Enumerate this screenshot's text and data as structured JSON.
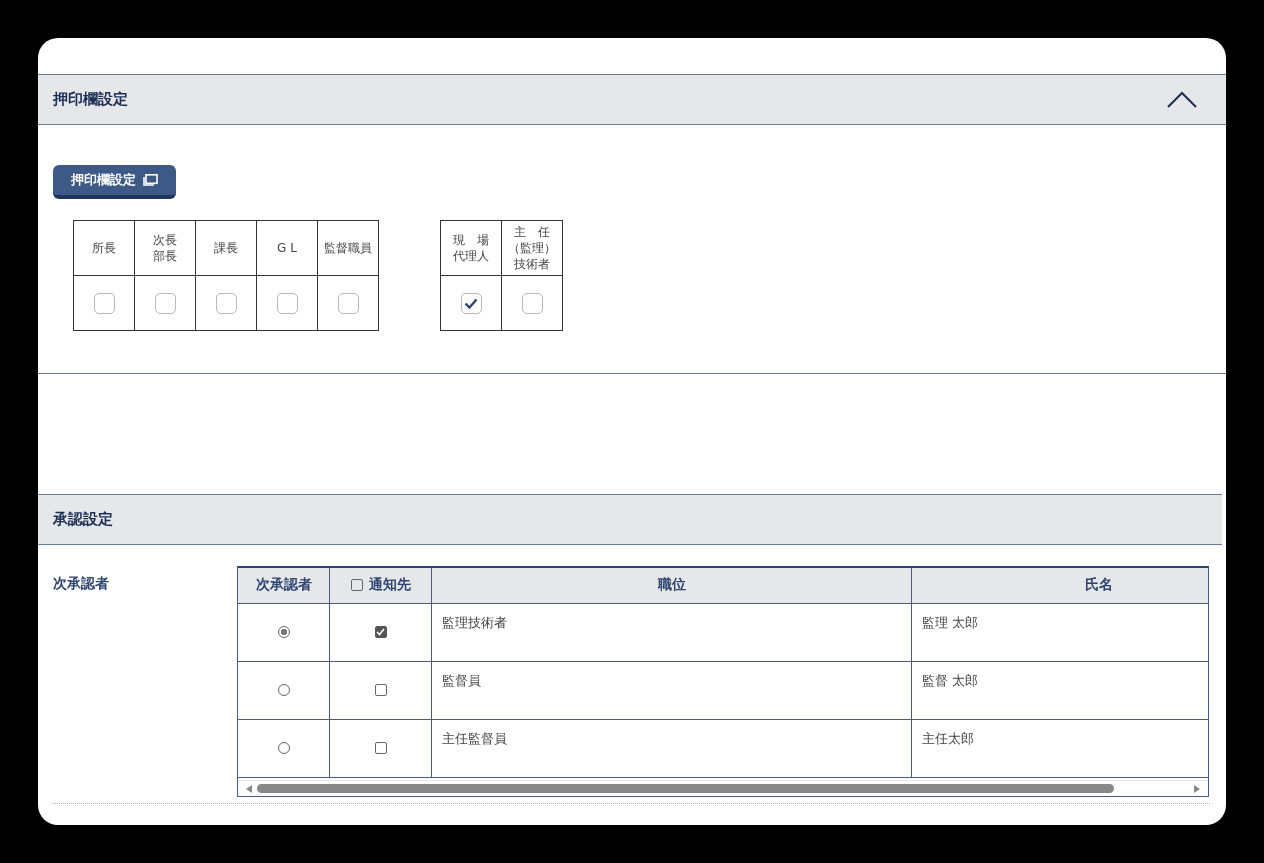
{
  "seal_section": {
    "title": "押印欄設定",
    "expanded": true,
    "button": "押印欄設定",
    "groups": [
      {
        "columns": [
          {
            "lines": [
              "所長"
            ],
            "checked": false
          },
          {
            "lines": [
              "次長",
              "部長"
            ],
            "checked": false
          },
          {
            "lines": [
              "課長"
            ],
            "checked": false
          },
          {
            "lines": [
              "G L"
            ],
            "checked": false
          },
          {
            "lines": [
              "監督職員"
            ],
            "checked": false
          }
        ]
      },
      {
        "columns": [
          {
            "lines": [
              "現　場",
              "代理人"
            ],
            "checked": true
          },
          {
            "lines": [
              "主　任",
              "（監理）",
              "技術者"
            ],
            "checked": false
          }
        ]
      }
    ]
  },
  "approval_section": {
    "title": "承認設定",
    "field_label": "次承認者",
    "table": {
      "columns": [
        "次承認者",
        "通知先",
        "職位",
        "氏名"
      ],
      "notify_all_checked": false,
      "rows": [
        {
          "selected": true,
          "notify": true,
          "position": "監理技術者",
          "name": "監理 太郎"
        },
        {
          "selected": false,
          "notify": false,
          "position": "監督員",
          "name": "監督 太郎"
        },
        {
          "selected": false,
          "notify": false,
          "position": "主任監督員",
          "name": "主任太郎"
        }
      ]
    }
  }
}
